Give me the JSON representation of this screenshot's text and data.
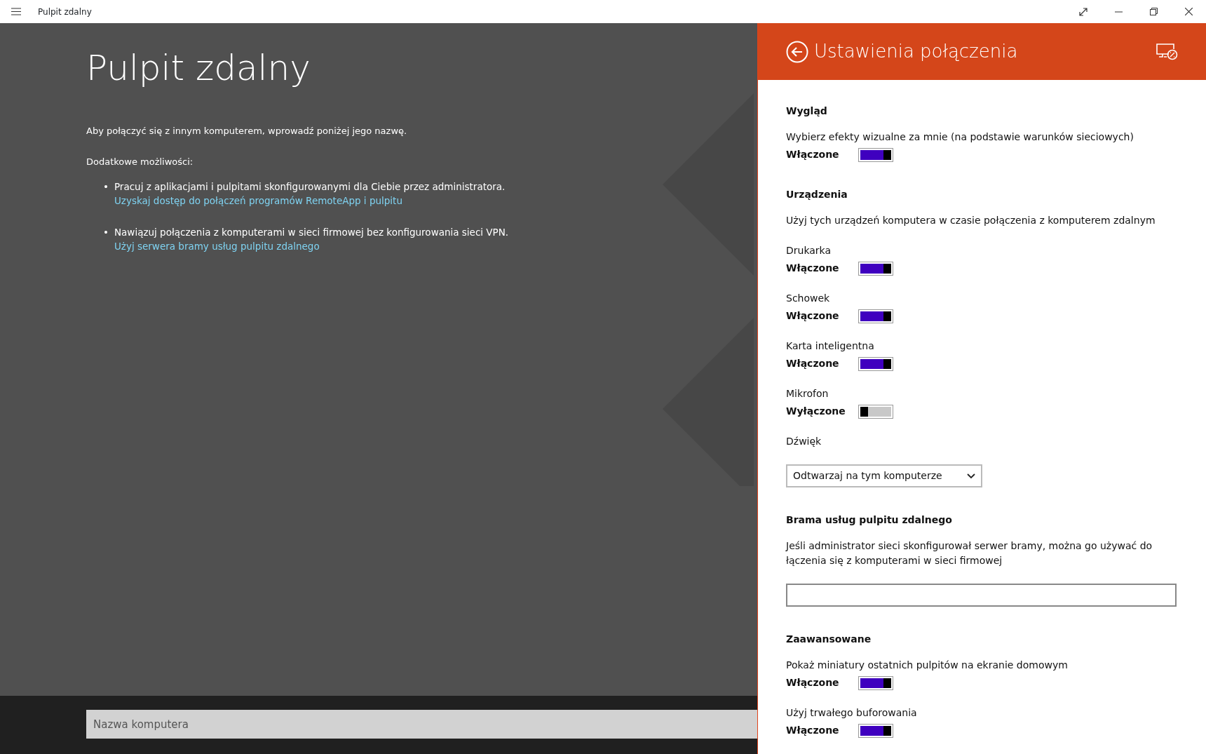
{
  "window": {
    "title": "Pulpit zdalny"
  },
  "main": {
    "heading": "Pulpit zdalny",
    "intro": "Aby połączyć się z innym komputerem, wprowadź poniżej jego nazwę.",
    "extras_label": "Dodatkowe możliwości:",
    "items": [
      {
        "bullet": "•",
        "text": "Pracuj z aplikacjami i pulpitami skonfigurowanymi dla Ciebie przez administratora.",
        "link": "Uzyskaj dostęp do połączeń programów RemoteApp i pulpitu"
      },
      {
        "bullet": "•",
        "text": "Nawiązuj połączenia z komputerami w sieci firmowej bez konfigurowania sieci VPN.",
        "link": "Użyj serwera bramy usług pulpitu zdalnego"
      }
    ],
    "computer_field": {
      "placeholder": "Nazwa komputera"
    }
  },
  "settings": {
    "title": "Ustawienia połączenia",
    "sections": [
      {
        "heading": "Wygląd",
        "items": [
          {
            "kind": "toggle",
            "label": "Wybierz efekty wizualne za mnie (na podstawie warunków sieciowych)",
            "state_text": "Włączone",
            "on": true
          }
        ]
      },
      {
        "heading": "Urządzenia",
        "description": "Użyj tych urządzeń komputera w czasie połączenia z komputerem zdalnym",
        "items": [
          {
            "kind": "toggle",
            "label": "Drukarka",
            "state_text": "Włączone",
            "on": true
          },
          {
            "kind": "toggle",
            "label": "Schowek",
            "state_text": "Włączone",
            "on": true
          },
          {
            "kind": "toggle",
            "label": "Karta inteligentna",
            "state_text": "Włączone",
            "on": true
          },
          {
            "kind": "toggle",
            "label": "Mikrofon",
            "state_text": "Wyłączone",
            "on": false
          },
          {
            "kind": "select",
            "label": "Dźwięk",
            "value": "Odtwarzaj na tym komputerze"
          }
        ]
      },
      {
        "heading": "Brama usług pulpitu zdalnego",
        "description": "Jeśli administrator sieci skonfigurował serwer bramy, można go używać do łączenia się z komputerami w sieci firmowej",
        "items": [
          {
            "kind": "text_field"
          }
        ]
      },
      {
        "heading": "Zaawansowane",
        "items": [
          {
            "kind": "toggle",
            "label": "Pokaż miniatury ostatnich pulpitów na ekranie domowym",
            "state_text": "Włączone",
            "on": true
          },
          {
            "kind": "toggle",
            "label": "Użyj trwałego buforowania",
            "state_text": "Włączone",
            "on": true
          }
        ]
      }
    ]
  }
}
